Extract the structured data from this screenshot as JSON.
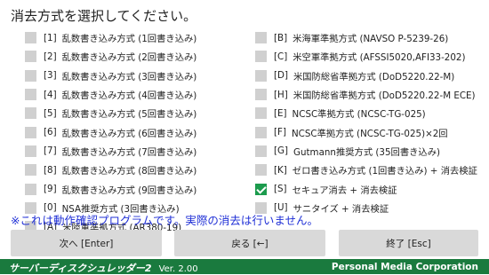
{
  "title": "消去方式を選択してください。",
  "left_options": [
    {
      "code": "[1]",
      "label": "乱数書き込み方式 (1回書き込み)",
      "checked": false
    },
    {
      "code": "[2]",
      "label": "乱数書き込み方式 (2回書き込み)",
      "checked": false
    },
    {
      "code": "[3]",
      "label": "乱数書き込み方式 (3回書き込み)",
      "checked": false
    },
    {
      "code": "[4]",
      "label": "乱数書き込み方式 (4回書き込み)",
      "checked": false
    },
    {
      "code": "[5]",
      "label": "乱数書き込み方式 (5回書き込み)",
      "checked": false
    },
    {
      "code": "[6]",
      "label": "乱数書き込み方式 (6回書き込み)",
      "checked": false
    },
    {
      "code": "[7]",
      "label": "乱数書き込み方式 (7回書き込み)",
      "checked": false
    },
    {
      "code": "[8]",
      "label": "乱数書き込み方式 (8回書き込み)",
      "checked": false
    },
    {
      "code": "[9]",
      "label": "乱数書き込み方式 (9回書き込み)",
      "checked": false
    },
    {
      "code": "[0]",
      "label": "NSA推奨方式 (3回書き込み)",
      "checked": false
    },
    {
      "code": "[A]",
      "label": "米陸軍準拠方式 (AR380-19)",
      "checked": false
    }
  ],
  "right_options": [
    {
      "code": "[B]",
      "label": "米海軍準拠方式 (NAVSO P-5239-26)",
      "checked": false
    },
    {
      "code": "[C]",
      "label": "米空軍準拠方式 (AFSSI5020,AFI33-202)",
      "checked": false
    },
    {
      "code": "[D]",
      "label": "米国防総省準拠方式 (DoD5220.22-M)",
      "checked": false
    },
    {
      "code": "[H]",
      "label": "米国防総省準拠方式 (DoD5220.22-M ECE)",
      "checked": false
    },
    {
      "code": "[E]",
      "label": "NCSC準拠方式 (NCSC-TG-025)",
      "checked": false
    },
    {
      "code": "[F]",
      "label": "NCSC準拠方式 (NCSC-TG-025)×2回",
      "checked": false
    },
    {
      "code": "[G]",
      "label": "Gutmann推奨方式 (35回書き込み)",
      "checked": false
    },
    {
      "code": "[K]",
      "label": "ゼロ書き込み方式 (1回書き込み) + 消去検証",
      "checked": false
    },
    {
      "code": "[S]",
      "label": "セキュア消去 + 消去検証",
      "checked": true
    },
    {
      "code": "[U]",
      "label": "サニタイズ + 消去検証",
      "checked": false
    }
  ],
  "notice": "※これは動作確認プログラムです。実際の消去は行いません。",
  "buttons": {
    "next": "次へ [Enter]",
    "back": "戻る [←]",
    "exit": "終了 [Esc]"
  },
  "footer": {
    "app_name": "サーバーディスクシュレッダー2",
    "version": "Ver. 2.00",
    "company": "Personal Media Corporation"
  },
  "colors": {
    "accent": "#1a7a3e",
    "checkbox_checked": "#1c9b4d",
    "notice": "#1f2fd6"
  }
}
